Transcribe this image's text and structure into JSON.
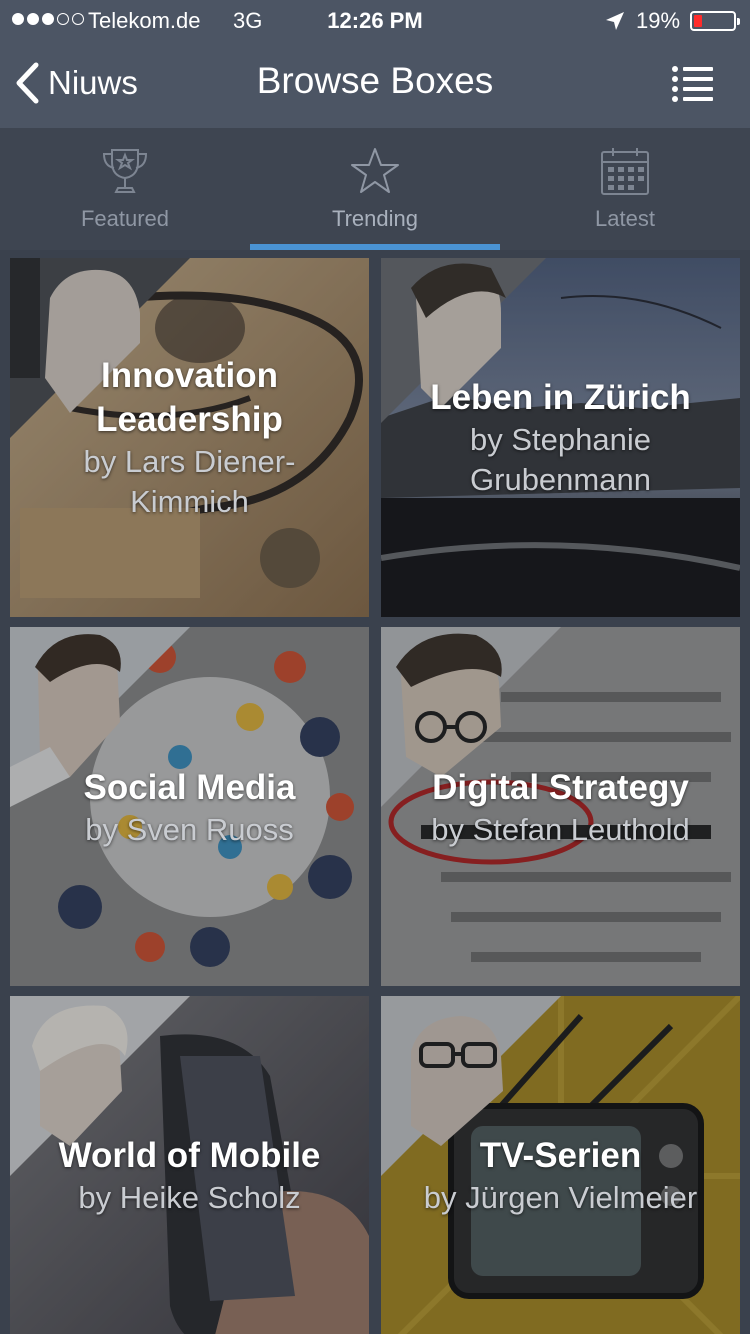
{
  "status_bar": {
    "carrier": "Telekom.de",
    "network": "3G",
    "time": "12:26 PM",
    "battery": "19%",
    "battery_level": 0.19,
    "signal_bars": 3,
    "signal_max": 5
  },
  "nav": {
    "back_label": "Niuws",
    "title": "Browse Boxes",
    "menu_icon": "list-icon"
  },
  "tabs": [
    {
      "label": "Featured",
      "icon": "trophy-icon",
      "active": false
    },
    {
      "label": "Trending",
      "icon": "star-icon",
      "active": true
    },
    {
      "label": "Latest",
      "icon": "calendar-icon",
      "active": false
    }
  ],
  "boxes": [
    {
      "title": "Innovation Leadership",
      "author": "by Lars Diener-Kimmich"
    },
    {
      "title": "Leben in Zürich",
      "author": "by Stephanie Grubenmann"
    },
    {
      "title": "Social Media",
      "author": "by Sven Ruoss"
    },
    {
      "title": "Digital Strategy",
      "author": "by Stefan Leuthold"
    },
    {
      "title": "World of Mobile",
      "author": "by Heike Scholz"
    },
    {
      "title": "TV-Serien",
      "author": "by Jürgen Vielmeier"
    }
  ],
  "colors": {
    "nav_bg": "#4c5564",
    "tab_bg": "#3e4551",
    "accent": "#4a93d3",
    "battery_low": "#ff2b2b"
  }
}
